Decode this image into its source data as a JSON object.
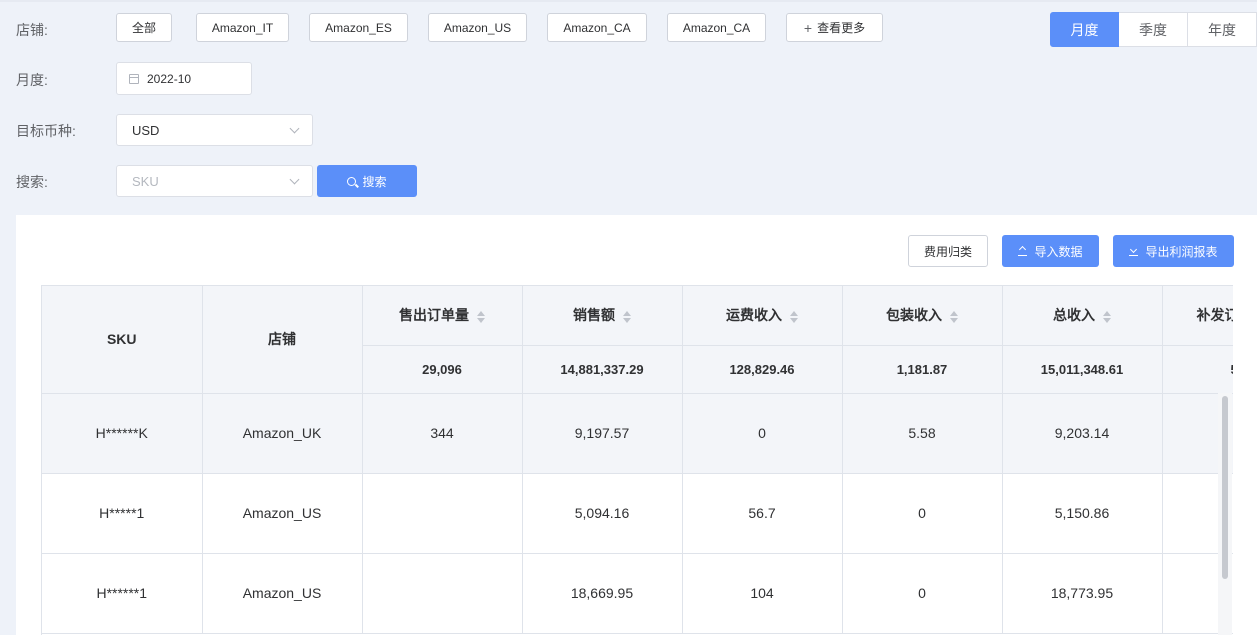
{
  "filters": {
    "store_label": "店铺:",
    "month_label": "月度:",
    "currency_label": "目标币种:",
    "search_label": "搜索:",
    "stores": [
      "全部",
      "Amazon_IT",
      "Amazon_ES",
      "Amazon_US",
      "Amazon_CA",
      "Amazon_CA"
    ],
    "more_label": "查看更多",
    "month_value": "2022-10",
    "currency_value": "USD",
    "sku_placeholder": "SKU",
    "search_button": "搜索"
  },
  "period": {
    "options": [
      "月度",
      "季度",
      "年度"
    ],
    "active": "月度"
  },
  "actions": {
    "categorize": "费用归类",
    "import": "导入数据",
    "export": "导出利润报表"
  },
  "table": {
    "columns": [
      "SKU",
      "店铺",
      "售出订单量",
      "销售额",
      "运费收入",
      "包装收入",
      "总收入",
      "补发订"
    ],
    "totals": [
      "29,096",
      "14,881,337.29",
      "128,829.46",
      "1,181.87",
      "15,011,348.61",
      "5"
    ],
    "rows": [
      {
        "sku": "H******K",
        "store": "Amazon_UK",
        "orders": "344",
        "sales": "9,197.57",
        "shipping": "0",
        "packaging": "5.58",
        "total": "9,203.14",
        "reship": ""
      },
      {
        "sku": "H*****1",
        "store": "Amazon_US",
        "orders": "",
        "sales": "5,094.16",
        "shipping": "56.7",
        "packaging": "0",
        "total": "5,150.86",
        "reship": ""
      },
      {
        "sku": "H******1",
        "store": "Amazon_US",
        "orders": "",
        "sales": "18,669.95",
        "shipping": "104",
        "packaging": "0",
        "total": "18,773.95",
        "reship": ""
      }
    ]
  }
}
